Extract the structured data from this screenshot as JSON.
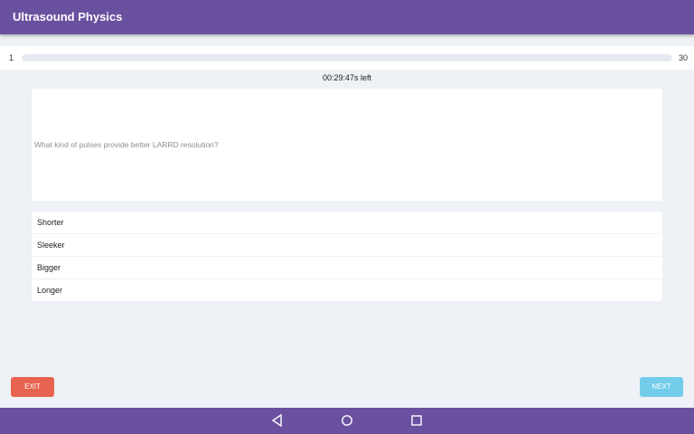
{
  "app": {
    "title": "Ultrasound Physics",
    "colors": {
      "app_bar": "#6a51a0",
      "exit": "#e8634f",
      "next": "#72cdea"
    }
  },
  "progress": {
    "start_label": "1",
    "end_label": "30",
    "fraction": 0.0
  },
  "timer": {
    "text": "00:29:47s left"
  },
  "question": {
    "text": "What kind of pulses provide better LARRD resolution?"
  },
  "answers": [
    {
      "label": "Shorter"
    },
    {
      "label": "Sleeker"
    },
    {
      "label": "Bigger"
    },
    {
      "label": "Longer"
    }
  ],
  "buttons": {
    "exit_label": "EXIT",
    "next_label": "NEXT"
  },
  "nav": {
    "icons": [
      "back-icon",
      "home-icon",
      "recents-icon"
    ]
  }
}
